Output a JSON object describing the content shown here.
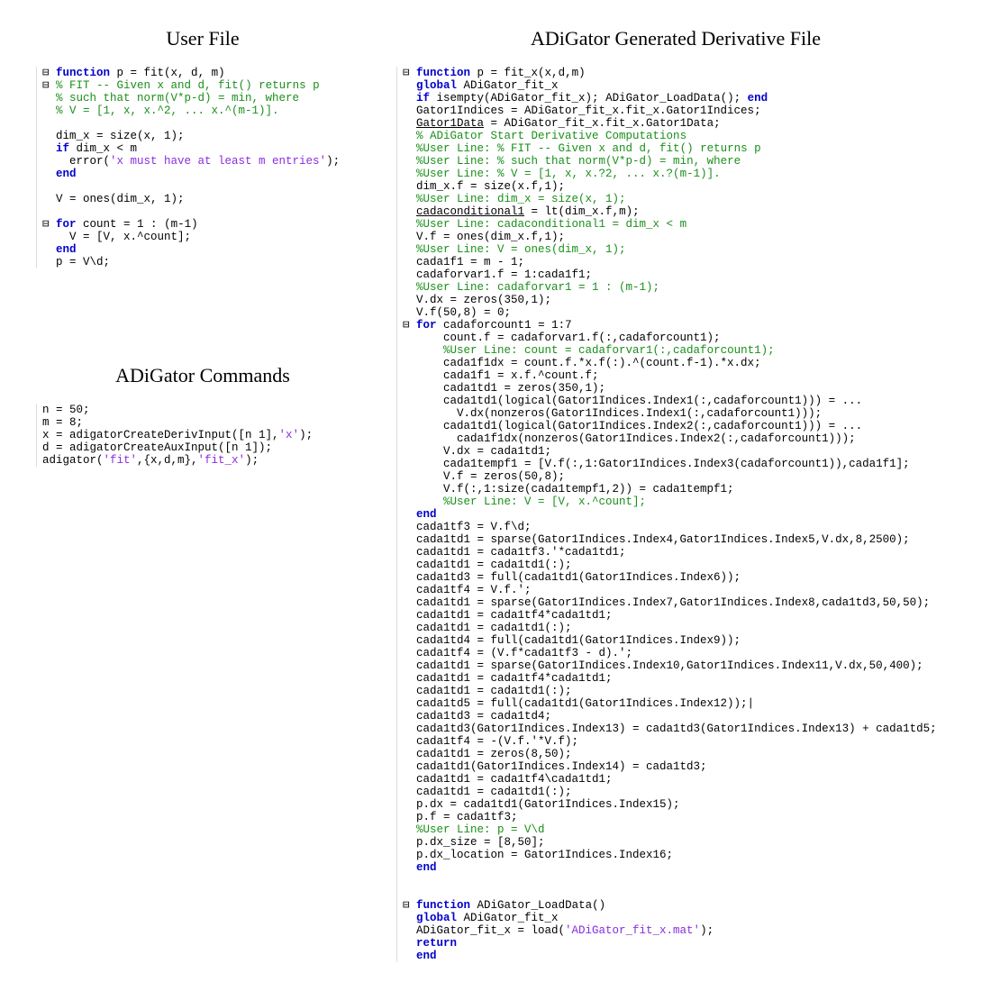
{
  "titles": {
    "user_file": "User File",
    "adigator_commands": "ADiGator Commands",
    "generated_file": "ADiGator Generated Derivative File"
  },
  "user_file_lines": [
    {
      "cls": "",
      "pre": "⊟ ",
      "html": "<span class='kw'>function</span> p = fit(x, d, m)"
    },
    {
      "cls": "cm",
      "pre": "⊟ ",
      "html": "% FIT -- Given x and d, fit() returns p"
    },
    {
      "cls": "cm",
      "pre": "  ",
      "html": "% such that norm(V*p-d) = min, where"
    },
    {
      "cls": "cm",
      "pre": "  ",
      "html": "% V = [1, x, x.^2, ... x.^(m-1)]."
    },
    {
      "cls": "",
      "pre": "  ",
      "html": ""
    },
    {
      "cls": "",
      "pre": "  ",
      "html": "dim_x = size(x, 1);"
    },
    {
      "cls": "",
      "pre": "  ",
      "html": "<span class='kw'>if</span> dim_x &lt; m"
    },
    {
      "cls": "",
      "pre": "  ",
      "html": "  error(<span class='str'>'x must have at least m entries'</span>);"
    },
    {
      "cls": "",
      "pre": "  ",
      "html": "<span class='kw'>end</span>"
    },
    {
      "cls": "",
      "pre": "  ",
      "html": ""
    },
    {
      "cls": "",
      "pre": "  ",
      "html": "V = ones(dim_x, 1);"
    },
    {
      "cls": "",
      "pre": "  ",
      "html": ""
    },
    {
      "cls": "",
      "pre": "⊟ ",
      "html": "<span class='kw'>for</span> count = 1 : (m-1)"
    },
    {
      "cls": "",
      "pre": "  ",
      "html": "  V = [V, x.^count];"
    },
    {
      "cls": "",
      "pre": "  ",
      "html": "<span class='kw'>end</span>"
    },
    {
      "cls": "",
      "pre": "  ",
      "html": "p = V\\d;"
    }
  ],
  "adigator_commands_lines": [
    {
      "cls": "",
      "html": "n = 50;"
    },
    {
      "cls": "",
      "html": "m = 8;"
    },
    {
      "cls": "",
      "html": "x = adigatorCreateDerivInput([n 1],<span class='str'>'x'</span>);"
    },
    {
      "cls": "",
      "html": "d = adigatorCreateAuxInput([n 1]);"
    },
    {
      "cls": "",
      "html": "adigator(<span class='str'>'fit'</span>,{x,d,m},<span class='str'>'fit_x'</span>);"
    }
  ],
  "generated_file_lines": [
    {
      "pre": "⊟ ",
      "html": "<span class='kw'>function</span> p = fit_x(x,d,m)"
    },
    {
      "pre": "  ",
      "html": "<span class='kw'>global</span> ADiGator_fit_x"
    },
    {
      "pre": "  ",
      "html": "<span class='kw'>if</span> isempty(ADiGator_fit_x); ADiGator_LoadData(); <span class='kw'>end</span>"
    },
    {
      "pre": "  ",
      "html": "Gator1Indices = ADiGator_fit_x.fit_x.Gator1Indices;"
    },
    {
      "pre": "  ",
      "html": "<u>Gator1Data</u> = ADiGator_fit_x.fit_x.Gator1Data;"
    },
    {
      "pre": "  ",
      "html": "<span class='cm'>% ADiGator Start Derivative Computations</span>"
    },
    {
      "pre": "  ",
      "html": "<span class='cm'>%User Line: % FIT -- Given x and d, fit() returns p</span>"
    },
    {
      "pre": "  ",
      "html": "<span class='cm'>%User Line: % such that norm(V*p-d) = min, where</span>"
    },
    {
      "pre": "  ",
      "html": "<span class='cm'>%User Line: % V = [1, x, x.?2, ... x.?(m-1)].</span>"
    },
    {
      "pre": "  ",
      "html": "dim_x.f = size(x.f,1);"
    },
    {
      "pre": "  ",
      "html": "<span class='cm'>%User Line: dim_x = size(x, 1);</span>"
    },
    {
      "pre": "  ",
      "html": "<u>cadaconditional1</u> = lt(dim_x.f,m);"
    },
    {
      "pre": "  ",
      "html": "<span class='cm'>%User Line: cadaconditional1 = dim_x &lt; m</span>"
    },
    {
      "pre": "  ",
      "html": "V.f = ones(dim_x.f,1);"
    },
    {
      "pre": "  ",
      "html": "<span class='cm'>%User Line: V = ones(dim_x, 1);</span>"
    },
    {
      "pre": "  ",
      "html": "cada1f1 = m - 1;"
    },
    {
      "pre": "  ",
      "html": "cadaforvar1.f = 1:cada1f1;"
    },
    {
      "pre": "  ",
      "html": "<span class='cm'>%User Line: cadaforvar1 = 1 : (m-1);</span>"
    },
    {
      "pre": "  ",
      "html": "V.dx = zeros(350,1);"
    },
    {
      "pre": "  ",
      "html": "V.f(50,8) = 0;"
    },
    {
      "pre": "⊟ ",
      "html": "<span class='kw'>for</span> cadaforcount1 = 1:7"
    },
    {
      "pre": "  ",
      "html": "    count.f = cadaforvar1.f(:,cadaforcount1);"
    },
    {
      "pre": "  ",
      "html": "    <span class='cm'>%User Line: count = cadaforvar1(:,cadaforcount1);</span>"
    },
    {
      "pre": "  ",
      "html": "    cada1f1dx = count.f.*x.f(:).^(count.f-1).*x.dx;"
    },
    {
      "pre": "  ",
      "html": "    cada1f1 = x.f.^count.f;"
    },
    {
      "pre": "  ",
      "html": "    cada1td1 = zeros(350,1);"
    },
    {
      "pre": "  ",
      "html": "    cada1td1(logical(Gator1Indices.Index1(:,cadaforcount1))) = ..."
    },
    {
      "pre": "  ",
      "html": "      V.dx(nonzeros(Gator1Indices.Index1(:,cadaforcount1)));"
    },
    {
      "pre": "  ",
      "html": "    cada1td1(logical(Gator1Indices.Index2(:,cadaforcount1))) = ..."
    },
    {
      "pre": "  ",
      "html": "      cada1f1dx(nonzeros(Gator1Indices.Index2(:,cadaforcount1)));"
    },
    {
      "pre": "  ",
      "html": "    V.dx = cada1td1;"
    },
    {
      "pre": "  ",
      "html": "    cada1tempf1 = [V.f(:,1:Gator1Indices.Index3(cadaforcount1)),cada1f1];"
    },
    {
      "pre": "  ",
      "html": "    V.f = zeros(50,8);"
    },
    {
      "pre": "  ",
      "html": "    V.f(:,1:size(cada1tempf1,2)) = cada1tempf1;"
    },
    {
      "pre": "  ",
      "html": "    <span class='cm'>%User Line: V = [V, x.^count];</span>"
    },
    {
      "pre": "  ",
      "html": "<span class='kw'>end</span>"
    },
    {
      "pre": "  ",
      "html": "cada1tf3 = V.f\\d;"
    },
    {
      "pre": "  ",
      "html": "cada1td1 = sparse(Gator1Indices.Index4,Gator1Indices.Index5,V.dx,8,2500);"
    },
    {
      "pre": "  ",
      "html": "cada1td1 = cada1tf3.'*cada1td1;"
    },
    {
      "pre": "  ",
      "html": "cada1td1 = cada1td1(:);"
    },
    {
      "pre": "  ",
      "html": "cada1td3 = full(cada1td1(Gator1Indices.Index6));"
    },
    {
      "pre": "  ",
      "html": "cada1tf4 = V.f.';"
    },
    {
      "pre": "  ",
      "html": "cada1td1 = sparse(Gator1Indices.Index7,Gator1Indices.Index8,cada1td3,50,50);"
    },
    {
      "pre": "  ",
      "html": "cada1td1 = cada1tf4*cada1td1;"
    },
    {
      "pre": "  ",
      "html": "cada1td1 = cada1td1(:);"
    },
    {
      "pre": "  ",
      "html": "cada1td4 = full(cada1td1(Gator1Indices.Index9));"
    },
    {
      "pre": "  ",
      "html": "cada1tf4 = (V.f*cada1tf3 - d).';"
    },
    {
      "pre": "  ",
      "html": "cada1td1 = sparse(Gator1Indices.Index10,Gator1Indices.Index11,V.dx,50,400);"
    },
    {
      "pre": "  ",
      "html": "cada1td1 = cada1tf4*cada1td1;"
    },
    {
      "pre": "  ",
      "html": "cada1td1 = cada1td1(:);"
    },
    {
      "pre": "  ",
      "html": "cada1td5 = full(cada1td1(Gator1Indices.Index12));|"
    },
    {
      "pre": "  ",
      "html": "cada1td3 = cada1td4;"
    },
    {
      "pre": "  ",
      "html": "cada1td3(Gator1Indices.Index13) = cada1td3(Gator1Indices.Index13) + cada1td5;"
    },
    {
      "pre": "  ",
      "html": "cada1tf4 = -(V.f.'*V.f);"
    },
    {
      "pre": "  ",
      "html": "cada1td1 = zeros(8,50);"
    },
    {
      "pre": "  ",
      "html": "cada1td1(Gator1Indices.Index14) = cada1td3;"
    },
    {
      "pre": "  ",
      "html": "cada1td1 = cada1tf4\\cada1td1;"
    },
    {
      "pre": "  ",
      "html": "cada1td1 = cada1td1(:);"
    },
    {
      "pre": "  ",
      "html": "p.dx = cada1td1(Gator1Indices.Index15);"
    },
    {
      "pre": "  ",
      "html": "p.f = cada1tf3;"
    },
    {
      "pre": "  ",
      "html": "<span class='cm'>%User Line: p = V\\d</span>"
    },
    {
      "pre": "  ",
      "html": "p.dx_size = [8,50];"
    },
    {
      "pre": "  ",
      "html": "p.dx_location = Gator1Indices.Index16;"
    },
    {
      "pre": "  ",
      "html": "<span class='kw'>end</span>"
    },
    {
      "pre": "  ",
      "html": ""
    },
    {
      "pre": "  ",
      "html": ""
    },
    {
      "pre": "⊟ ",
      "html": "<span class='kw'>function</span> ADiGator_LoadData()"
    },
    {
      "pre": "  ",
      "html": "<span class='kw'>global</span> ADiGator_fit_x"
    },
    {
      "pre": "  ",
      "html": "ADiGator_fit_x = load(<span class='str'>'ADiGator_fit_x.mat'</span>);"
    },
    {
      "pre": "  ",
      "html": "<span class='kw'>return</span>"
    },
    {
      "pre": "  ",
      "html": "<span class='kw'>end</span>"
    }
  ]
}
